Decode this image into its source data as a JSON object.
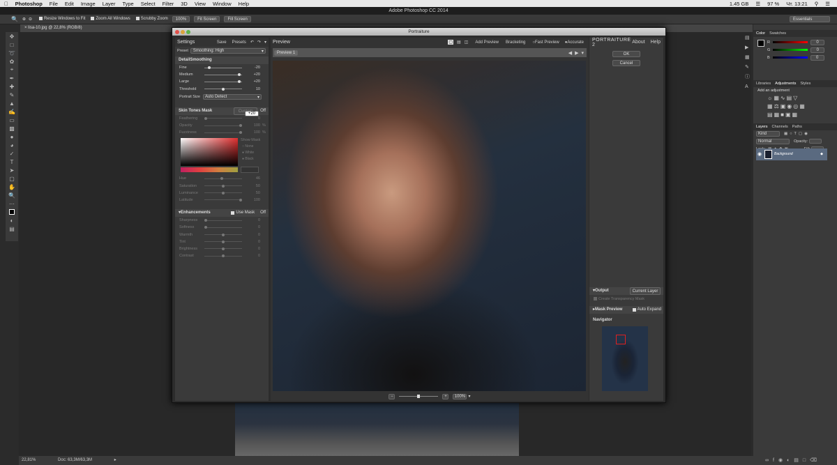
{
  "mac_menu": {
    "apple": "",
    "app": "Photoshop",
    "items": [
      "File",
      "Edit",
      "Image",
      "Layer",
      "Type",
      "Select",
      "Filter",
      "3D",
      "View",
      "Window",
      "Help"
    ],
    "status_right": {
      "disk": "1.45 GB",
      "battery": "97 %",
      "clock": "Чт. 13:21"
    }
  },
  "ps_title": "Adobe Photoshop CC 2014",
  "options_bar": {
    "resize_windows": "Resize Windows to Fit",
    "zoom_all_windows": "Zoom All Windows",
    "scrubby_zoom": "Scrubby Zoom",
    "btn_100": "100%",
    "btn_fit": "Fit Screen",
    "btn_fill": "Fill Screen",
    "workspace": "Essentials"
  },
  "document_tab": "lisa-10.jpg @ 22,8% (RGB/8)",
  "status_bar": {
    "zoom": "22,81%",
    "doc": "Doc: 63,3M/63,3M"
  },
  "plugin": {
    "window_title": "Portraiture",
    "settings": {
      "header": "Settings",
      "save": "Save",
      "presets": "Presets",
      "preset_label": "Preset",
      "preset_value": "Smoothing: High",
      "detail_section": "DetailSmoothing",
      "detail_rows": [
        {
          "label": "Fine",
          "value": "-20",
          "pos": 0.1
        },
        {
          "label": "Medium",
          "value": "+20",
          "pos": 0.95
        },
        {
          "label": "Large",
          "value": "+20",
          "pos": 0.95
        },
        {
          "label": "Threshold",
          "value": "10",
          "pos": 0.5
        }
      ],
      "large_input": "+20",
      "portrait_size_label": "Portrait Size",
      "portrait_size_value": "Auto Detect",
      "skin_section": "Skin Tones Mask",
      "skin_mode": "Custom",
      "skin_off": "Off",
      "skin_rows": [
        {
          "label": "Feathering",
          "value": "0",
          "unit": "",
          "pos": 0.0
        },
        {
          "label": "Opacity",
          "value": "100",
          "unit": "%",
          "pos": 1.0
        },
        {
          "label": "Fuzziness",
          "value": "100",
          "unit": "%",
          "pos": 1.0
        }
      ],
      "show_mask": "Show Mask",
      "mask_options": [
        "None",
        "White",
        "Black"
      ],
      "hue_rows": [
        {
          "label": "Hue",
          "value": "46",
          "pos": 0.45
        },
        {
          "label": "Saturation",
          "value": "50",
          "pos": 0.5
        },
        {
          "label": "Luminance",
          "value": "50",
          "pos": 0.5
        },
        {
          "label": "Latitude",
          "value": "100",
          "pos": 1.0
        }
      ],
      "enh_section": "Enhancements",
      "use_mask": "Use Mask",
      "enh_off": "Off",
      "enh_rows": [
        {
          "label": "Sharpness",
          "value": "0",
          "pos": 0.0
        },
        {
          "label": "Softness",
          "value": "0",
          "pos": 0.0
        },
        {
          "label": "Warmth",
          "value": "0",
          "pos": 0.5
        },
        {
          "label": "Tint",
          "value": "0",
          "pos": 0.5
        },
        {
          "label": "Brightness",
          "value": "0",
          "pos": 0.5
        },
        {
          "label": "Contrast",
          "value": "0",
          "pos": 0.5
        }
      ]
    },
    "preview": {
      "header": "Preview",
      "add_preview": "Add Preview",
      "bracketing": "Bracketing",
      "fast_preview": "Fast Preview",
      "accurate": "Accurate",
      "tab": "Preview 1",
      "zoom": "100%"
    },
    "right": {
      "brand": "PORTRAITURE 2",
      "about": "About",
      "help": "Help",
      "ok": "OK",
      "cancel": "Cancel",
      "output_label": "Output",
      "output_value": "Current Layer",
      "create_mask": "Create Transparency Mask",
      "mask_preview": "Mask Preview",
      "auto_expand": "Auto Expand",
      "navigator": "Navigator"
    }
  },
  "right_panels": {
    "color_tabs": [
      "Color",
      "Swatches"
    ],
    "rgb_labels": [
      "R",
      "G",
      "B"
    ],
    "rgb_values": [
      "0",
      "0",
      "0"
    ],
    "adj_tabs": [
      "Libraries",
      "Adjustments",
      "Styles"
    ],
    "add_adjustment": "Add an adjustment",
    "layer_tabs": [
      "Layers",
      "Channels",
      "Paths"
    ],
    "kind": "Kind",
    "blend": "Normal",
    "opacity_label": "Opacity:",
    "lock_label": "Lock:",
    "fill_label": "Fill:",
    "layer_name": "Background"
  }
}
